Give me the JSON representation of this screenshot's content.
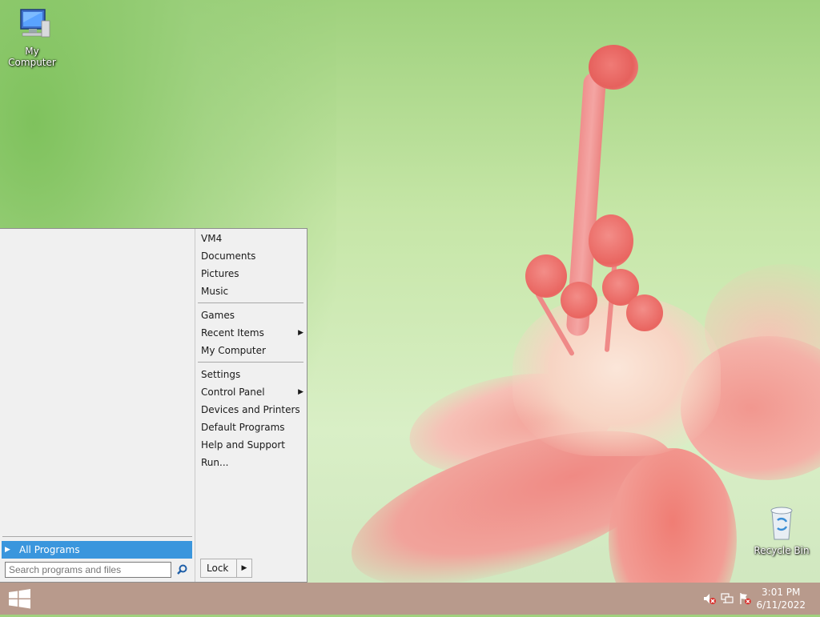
{
  "desktop": {
    "icons": [
      {
        "label": "My Computer",
        "icon": "computer-icon"
      },
      {
        "label": "Recycle Bin",
        "icon": "recycle-bin-icon"
      }
    ]
  },
  "start_menu": {
    "all_programs_label": "All Programs",
    "search_placeholder": "Search programs and files",
    "right_items": [
      {
        "label": "VM4"
      },
      {
        "label": "Documents"
      },
      {
        "label": "Pictures"
      },
      {
        "label": "Music"
      },
      {
        "label": "Games"
      },
      {
        "label": "Recent Items",
        "submenu": true
      },
      {
        "label": "My Computer"
      },
      {
        "label": "Settings"
      },
      {
        "label": "Control Panel",
        "submenu": true
      },
      {
        "label": "Devices and Printers"
      },
      {
        "label": "Default Programs"
      },
      {
        "label": "Help and Support"
      },
      {
        "label": "Run..."
      }
    ],
    "lock_label": "Lock"
  },
  "taskbar": {
    "start_icon": "windows-logo-icon",
    "tray_icons": [
      "volume-muted-icon",
      "network-icon",
      "action-center-flag-icon"
    ],
    "clock": {
      "time": "3:01 PM",
      "date": "6/11/2022"
    }
  },
  "colors": {
    "highlight": "#3a96dd",
    "taskbar": "#b89a8c",
    "menu_bg": "#f0f0f0"
  }
}
